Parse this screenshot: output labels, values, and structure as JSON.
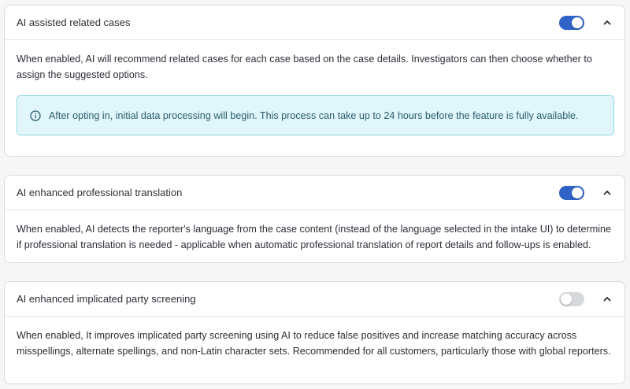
{
  "colors": {
    "toggle_on": "#2f63c8",
    "toggle_off": "#d6d8dc",
    "info_bg": "#e0f6fa",
    "info_border": "#8fd9e6"
  },
  "settings": [
    {
      "title": "AI assisted related cases",
      "enabled": true,
      "expanded": true,
      "description": "When enabled, AI will recommend related cases for each case based on the case details. Investigators can then choose whether to assign the suggested options.",
      "info": "After opting in, initial data processing will begin. This process can take up to 24 hours before the feature is fully available.",
      "info_icon": "info-circle-icon",
      "toggle_icon": "toggle-on",
      "chevron_icon": "chevron-up-icon"
    },
    {
      "title": "AI enhanced professional translation",
      "enabled": true,
      "expanded": true,
      "description": "When enabled, AI detects the reporter's language from the case content (instead of the language selected in the intake UI) to determine if professional translation is needed - applicable when automatic professional translation of report details and follow-ups is enabled.",
      "toggle_icon": "toggle-on",
      "chevron_icon": "chevron-up-icon"
    },
    {
      "title": "AI enhanced implicated party screening",
      "enabled": false,
      "expanded": true,
      "description": "When enabled, It improves implicated party screening using AI to reduce false positives and increase matching accuracy across misspellings, alternate spellings, and non-Latin character sets. Recommended for all customers, particularly those with global reporters.",
      "toggle_icon": "toggle-off",
      "chevron_icon": "chevron-up-icon"
    }
  ]
}
